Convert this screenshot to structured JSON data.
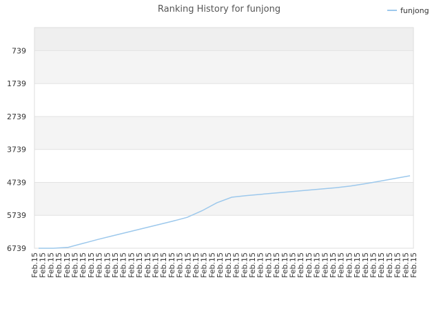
{
  "chart_data": {
    "type": "line",
    "title": "Ranking History for funjong",
    "xlabel": "",
    "ylabel": "",
    "y_reversed": true,
    "ylim": [
      6739,
      39
    ],
    "y_ticks": [
      739,
      1739,
      2739,
      3739,
      4739,
      5739,
      6739
    ],
    "band_colors": [
      "#efefef",
      "#f4f4f4",
      "#ffffff",
      "#f4f4f4",
      "#ffffff",
      "#f4f4f4",
      "#ffffff"
    ],
    "grid": true,
    "legend_position": "top-right",
    "x_tick_labels": [
      "Feb.15",
      "Feb.15",
      "Feb.15",
      "Feb.15",
      "Feb.15",
      "Feb.15",
      "Feb.15",
      "Feb.15",
      "Feb.15",
      "Feb.15",
      "Feb.15",
      "Feb.15",
      "Feb.15",
      "Feb.15",
      "Feb.15",
      "Feb.15",
      "Feb.15",
      "Feb.15",
      "Feb.15",
      "Feb.15",
      "Feb.15",
      "Feb.15",
      "Feb.15",
      "Feb.15",
      "Feb.15",
      "Feb.15",
      "Feb.15",
      "Feb.15",
      "Feb.15",
      "Feb.15",
      "Feb.15",
      "Feb.15",
      "Feb.15",
      "Feb.15",
      "Feb.15",
      "Feb.15",
      "Feb.15",
      "Feb.15",
      "Feb.15",
      "Feb.15",
      "Feb.15",
      "Feb.15",
      "Feb.15",
      "Feb.15",
      "Feb.15",
      "Feb.15",
      "Feb.15",
      "Feb.15"
    ],
    "series": [
      {
        "name": "funjong",
        "color": "#9cc8ec",
        "values": [
          6739,
          6739,
          6710,
          6590,
          6470,
          6360,
          6250,
          6140,
          6030,
          5920,
          5800,
          5600,
          5360,
          5190,
          5140,
          5100,
          5060,
          5020,
          4980,
          4940,
          4900,
          4850,
          4780,
          4700,
          4620,
          4539
        ]
      }
    ]
  }
}
